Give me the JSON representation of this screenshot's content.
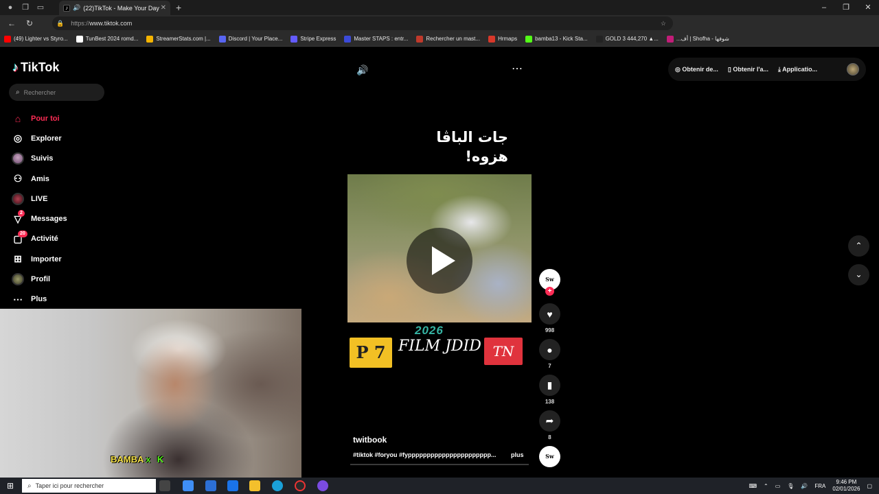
{
  "browser": {
    "tab_title": "(22)TikTok - Make Your Day",
    "url_protocol": "https://",
    "url_host": "www.tiktok.com",
    "bookmarks": [
      {
        "label": "(49) Lighter vs Styro...",
        "color": "#ff0000"
      },
      {
        "label": "TunBest 2024 romd...",
        "color": "#ffffff"
      },
      {
        "label": "StreamerStats.com |...",
        "color": "#f5b400"
      },
      {
        "label": "Discord | Your Place...",
        "color": "#5865f2"
      },
      {
        "label": "Stripe Express",
        "color": "#635bff"
      },
      {
        "label": "Master STAPS : entr...",
        "color": "#3b4ad8"
      },
      {
        "label": "Rechercher un mast...",
        "color": "#c0392b"
      },
      {
        "label": "Hrmaps",
        "color": "#d8382a"
      },
      {
        "label": "bamba13 - Kick Sta...",
        "color": "#53fc18"
      },
      {
        "label": "GOLD 3 444,270 ▲...",
        "color": "#222222"
      },
      {
        "label": "...أف | Shofha - شوفها",
        "color": "#c21d78"
      }
    ]
  },
  "sidebar": {
    "logo": "TikTok",
    "search_placeholder": "Rechercher",
    "items": [
      {
        "label": "Pour toi",
        "icon": "home-icon"
      },
      {
        "label": "Explorer",
        "icon": "compass-icon"
      },
      {
        "label": "Suivis",
        "icon": "following-avatar-icon"
      },
      {
        "label": "Amis",
        "icon": "friends-icon"
      },
      {
        "label": "LIVE",
        "icon": "live-icon"
      },
      {
        "label": "Messages",
        "icon": "message-icon",
        "badge": "2"
      },
      {
        "label": "Activité",
        "icon": "activity-icon",
        "badge": "20"
      },
      {
        "label": "Importer",
        "icon": "upload-icon"
      },
      {
        "label": "Profil",
        "icon": "profile-avatar-icon"
      },
      {
        "label": "Plus",
        "icon": "more-icon"
      }
    ]
  },
  "header_actions": {
    "coins": "Obtenir de...",
    "app": "Obtenir l'a...",
    "desktop": "Applicatio..."
  },
  "video": {
    "caption_line1": "جات الباڤا",
    "caption_line2": "هزوه!",
    "year": "2026",
    "tag_left": "P 7",
    "title": "FILM JDID",
    "tag_right": "TN",
    "author": "twitbook",
    "hashtags": "#tiktok #foryou #fypppppppppppppppppppppp...",
    "more": "plus",
    "creator_avatar": "Sw"
  },
  "actions": {
    "likes": "998",
    "comments": "7",
    "saves": "138",
    "shares": "8"
  },
  "overlay": {
    "streamer": "BAMBA",
    "x": "X",
    "k": "K"
  },
  "taskbar": {
    "search_placeholder": "Taper ici pour rechercher",
    "lang": "FRA",
    "time": "9:46 PM",
    "date": "02/01/2026"
  }
}
